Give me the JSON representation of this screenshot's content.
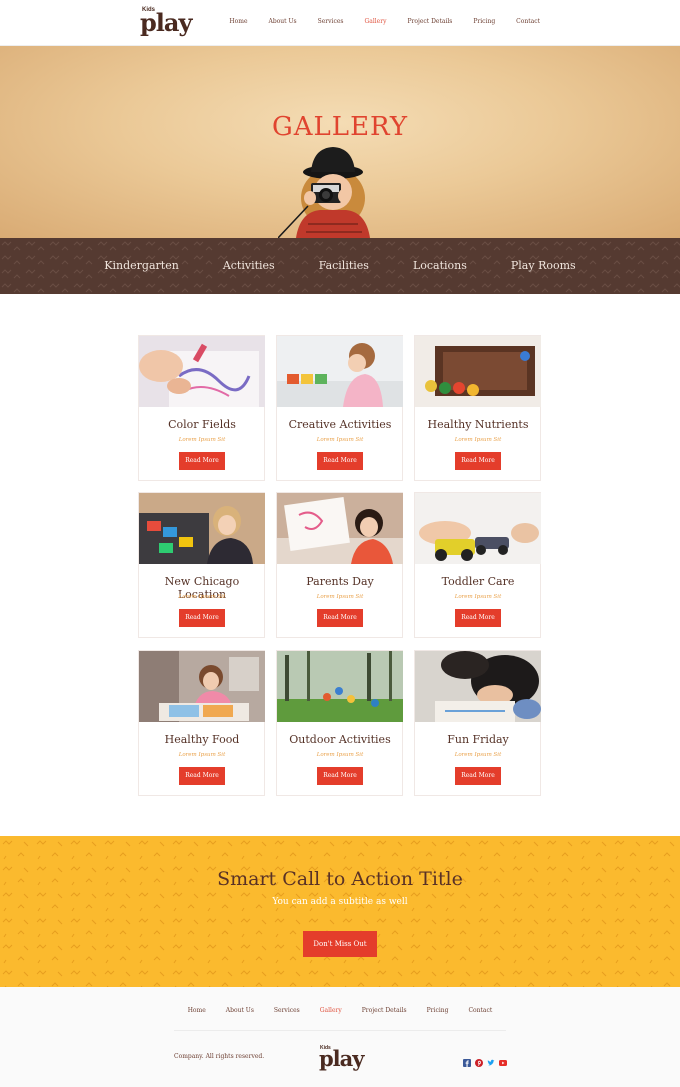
{
  "header": {
    "logo_small": "Kids",
    "logo_big": "play",
    "nav": [
      {
        "label": "Home",
        "active": false
      },
      {
        "label": "About Us",
        "active": false
      },
      {
        "label": "Services",
        "active": false
      },
      {
        "label": "Gallery",
        "active": true
      },
      {
        "label": "Project Details",
        "active": false
      },
      {
        "label": "Pricing",
        "active": false
      },
      {
        "label": "Contact",
        "active": false
      }
    ]
  },
  "hero": {
    "title": "GALLERY"
  },
  "categories": [
    "Kindergarten",
    "Activities",
    "Facilities",
    "Locations",
    "Play Rooms"
  ],
  "gallery": [
    {
      "title": "Color Fields",
      "subtitle": "Lorem Ipsum Sit",
      "button": "Read More"
    },
    {
      "title": "Creative Activities",
      "subtitle": "Lorem Ipsum Sit",
      "button": "Read More"
    },
    {
      "title": "Healthy Nutrients",
      "subtitle": "Lorem Ipsum Sit",
      "button": "Read More"
    },
    {
      "title": "New Chicago Location",
      "subtitle": "Lorem Ipsum Sit",
      "button": "Read More"
    },
    {
      "title": "Parents Day",
      "subtitle": "Lorem Ipsum Sit",
      "button": "Read More"
    },
    {
      "title": "Toddler Care",
      "subtitle": "Lorem Ipsum Sit",
      "button": "Read More"
    },
    {
      "title": "Healthy Food",
      "subtitle": "Lorem Ipsum Sit",
      "button": "Read More"
    },
    {
      "title": "Outdoor Activities",
      "subtitle": "Lorem Ipsum Sit",
      "button": "Read More"
    },
    {
      "title": "Fun Friday",
      "subtitle": "Lorem Ipsum Sit",
      "button": "Read More"
    }
  ],
  "cta": {
    "title": "Smart Call to Action Title",
    "subtitle": "You can add a subtitle as well",
    "button": "Don't Miss Out"
  },
  "footer": {
    "nav": [
      {
        "label": "Home",
        "active": false
      },
      {
        "label": "About Us",
        "active": false
      },
      {
        "label": "Services",
        "active": false
      },
      {
        "label": "Gallery",
        "active": true
      },
      {
        "label": "Project Details",
        "active": false
      },
      {
        "label": "Pricing",
        "active": false
      },
      {
        "label": "Contact",
        "active": false
      }
    ],
    "copyright": "Company. All rights reserved.",
    "logo_small": "Kids",
    "logo_big": "play",
    "social": [
      "facebook-icon",
      "pinterest-icon",
      "twitter-icon",
      "youtube-icon"
    ]
  },
  "colors": {
    "accent": "#e43d2b",
    "brown": "#553a31",
    "cta_yellow": "#fbba2e",
    "facebook": "#3b5998",
    "pinterest": "#cb2027",
    "twitter": "#1da1f2",
    "youtube": "#e52d27"
  }
}
